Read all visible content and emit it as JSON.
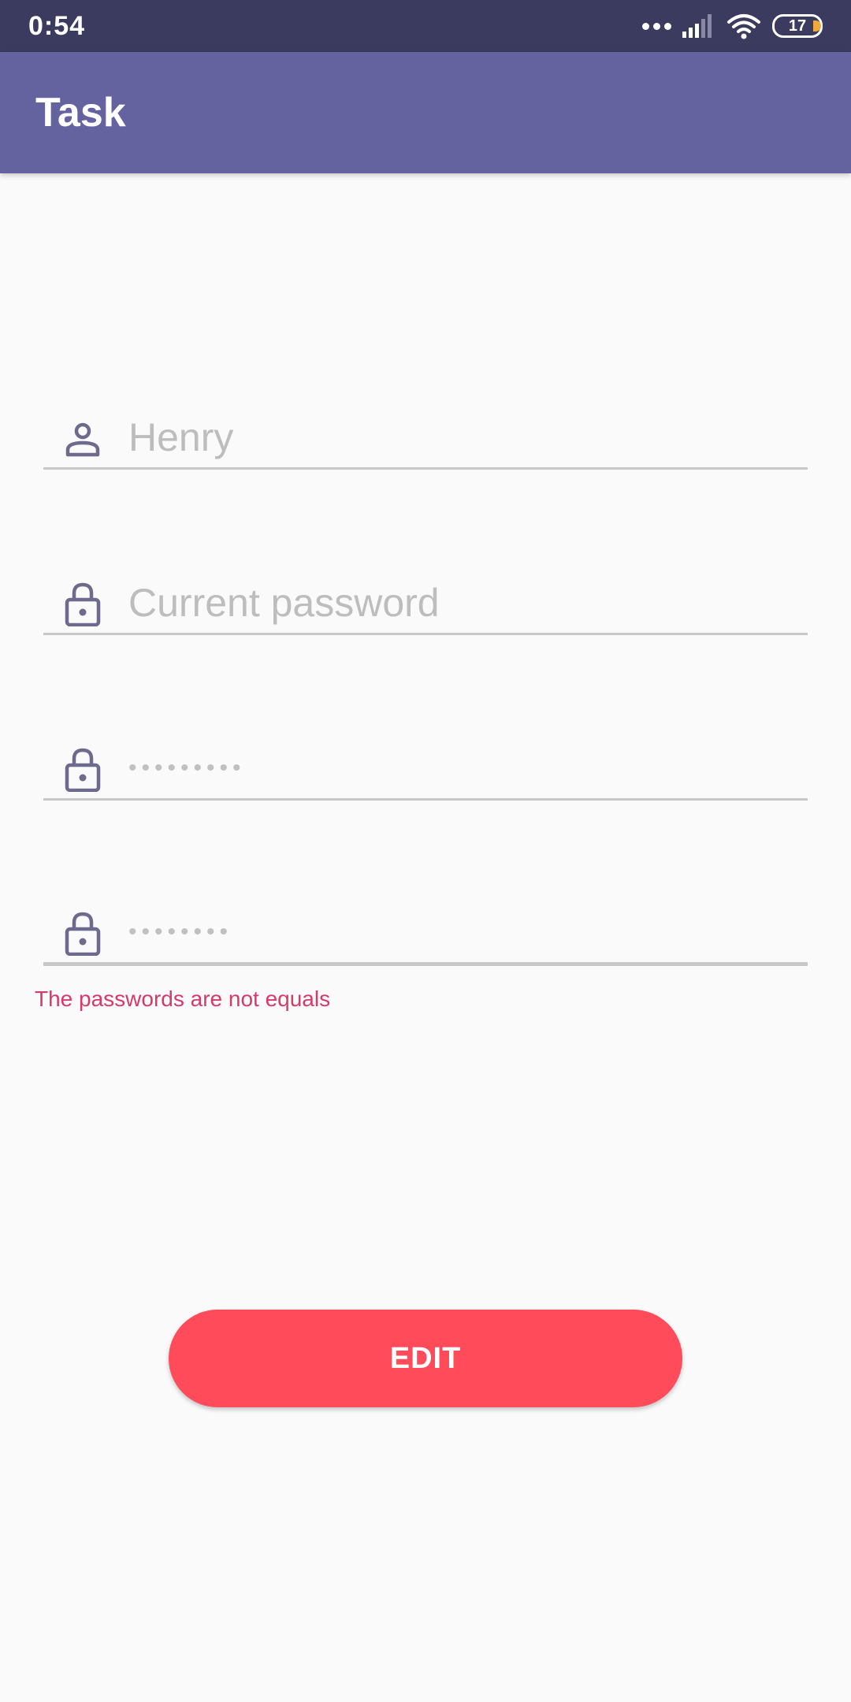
{
  "status_bar": {
    "time": "0:54",
    "battery_level": "17"
  },
  "app_bar": {
    "title": "Task"
  },
  "form": {
    "username": {
      "placeholder": "Henry",
      "icon": "person-icon"
    },
    "current_password": {
      "placeholder": "Current password",
      "icon": "lock-icon"
    },
    "new_password": {
      "value_masked": "•••••••••",
      "icon": "lock-icon"
    },
    "confirm_password": {
      "value_masked": "••••••••",
      "icon": "lock-icon"
    },
    "error_message": "The passwords are not equals"
  },
  "actions": {
    "edit_label": "EDIT"
  },
  "colors": {
    "status_bar": "#3b3a5f",
    "app_bar": "#6562a0",
    "icon": "#6e6a8e",
    "error": "#d63a6a",
    "button": "#ff4b5a"
  }
}
